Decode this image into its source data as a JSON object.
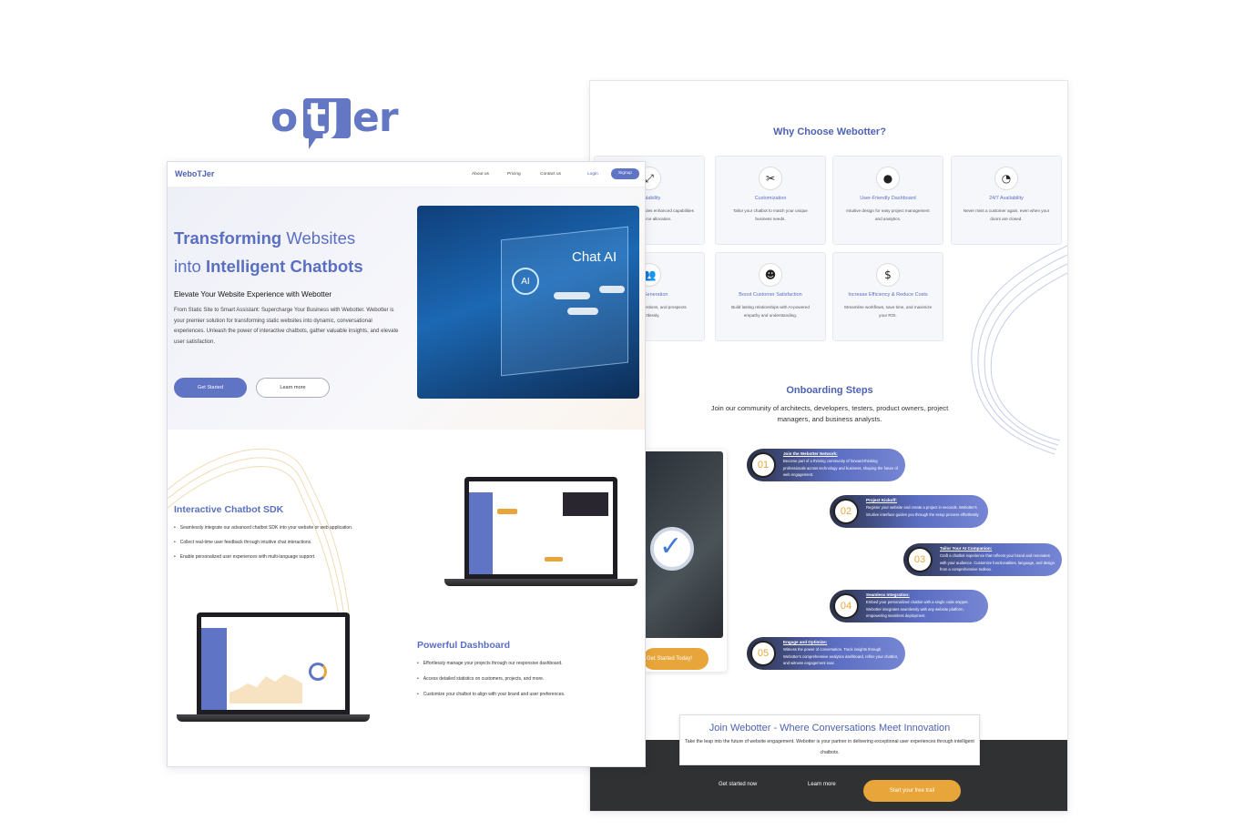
{
  "logo": {
    "o": "o",
    "tj": "tJ",
    "er": "er"
  },
  "landing": {
    "nav": {
      "brand": "WeboTJer",
      "links": [
        "About us",
        "Pricing",
        "Contact us"
      ],
      "login": "Login",
      "signup": "Signup"
    },
    "hero": {
      "title_line1_bold": "Transforming",
      "title_line1_rest": " Websites",
      "title_line2_pre": "into ",
      "title_line2_bold": "Intelligent Chatbots",
      "subtitle": "Elevate Your Website Experience with Webotter",
      "paragraph": "From Static Site to Smart Assistant: Supercharge Your Business with Webotter. Webotter is your premier solution for transforming static websites into dynamic, conversational experiences. Unleash the power of interactive chatbots, gather valuable insights, and elevate user satisfaction.",
      "get_started": "Get Started",
      "learn_more": "Learn more",
      "image_chat_label": "Chat AI",
      "image_ai_label": "AI"
    },
    "sdk": {
      "title": "Interactive Chatbot SDK",
      "bullets": [
        "Seamlessly integrate our advanced chatbot SDK into your website or web application.",
        "Collect real-time user feedback through intuitive chat interactions.",
        "Enable personalized user experiences with multi-language support."
      ]
    },
    "dashboard": {
      "title": "Powerful Dashboard",
      "bullets": [
        "Effortlessly manage your projects through our responsive dashboard.",
        "Access detailed statistics on customers, projects, and more.",
        "Customize your chatbot to align with your brand and user preferences."
      ]
    }
  },
  "features": {
    "title": "Why Choose Webotter?",
    "cards": [
      {
        "icon": "expand-arrows-icon",
        "glyph": "⤢",
        "title": "Scalability",
        "desc": "Our future scope includes enhanced capabilities and resource allocation."
      },
      {
        "icon": "tools-icon",
        "glyph": "✂",
        "title": "Customization",
        "desc": "Tailor your chatbot to match your unique business needs."
      },
      {
        "icon": "user-check-icon",
        "glyph": "●",
        "title": "User-Friendly Dashboard",
        "desc": "Intuitive design for easy project management and analytics."
      },
      {
        "icon": "clock-icon",
        "glyph": "◔",
        "title": "24/7 Availability",
        "desc": "Never miss a customer again, even when your doors are closed."
      },
      {
        "icon": "users-icon",
        "glyph": "👥",
        "title": "Lead Generation",
        "desc": "Answer power questions, and prospects effortlessly."
      },
      {
        "icon": "smile-icon",
        "glyph": "☻",
        "title": "Boost Customer Satisfaction",
        "desc": "Build lasting relationships with AI-powered empathy and understanding."
      },
      {
        "icon": "dollar-icon",
        "glyph": "$",
        "title": "Increase Efficiency & Reduce Costs",
        "desc": "Streamline workflows, save time, and maximize your ROI."
      }
    ]
  },
  "onboarding": {
    "title": "Onboarding Steps",
    "subtitle": "Join our community of architects, developers, testers, product owners, project managers, and business analysts.",
    "image_button": "Get Started Today!",
    "steps": [
      {
        "num": "01",
        "title": "Join the Webotter Network:",
        "desc": "Become part of a thriving community of forward-thinking professionals across technology and business, shaping the future of web engagement."
      },
      {
        "num": "02",
        "title": "Project Kickoff:",
        "desc": "Register your website and create a project in seconds. Webotter's intuitive interface guides you through the setup process effortlessly."
      },
      {
        "num": "03",
        "title": "Tailor Your AI Companion:",
        "desc": "Craft a chatbot experience that reflects your brand and resonates with your audience. Customize functionalities, language, and design from a comprehensive toolbox."
      },
      {
        "num": "04",
        "title": "Seamless Integration:",
        "desc": "Embed your personalized chatbot with a single code snippet. Webotter integrates seamlessly with any website platform, empowering seamless deployment."
      },
      {
        "num": "05",
        "title": "Engage and Optimize:",
        "desc": "Witness the power of conversation. Track insights through Webotter's comprehensive analytics dashboard, refine your chatbot, and witness engagement soar."
      }
    ]
  },
  "cta": {
    "title": "Join Webotter - Where Conversations Meet Innovation",
    "desc": "Take the leap into the future of website engagement. Webotter is your partner in delivering exceptional user experiences through intelligent chatbots.",
    "get_started_now": "Get started now",
    "learn_more": "Learn more",
    "free_trial": "Start your free trail"
  },
  "colors": {
    "brand": "#5f74c4",
    "accent": "#e8a53a",
    "dark": "#303133"
  }
}
